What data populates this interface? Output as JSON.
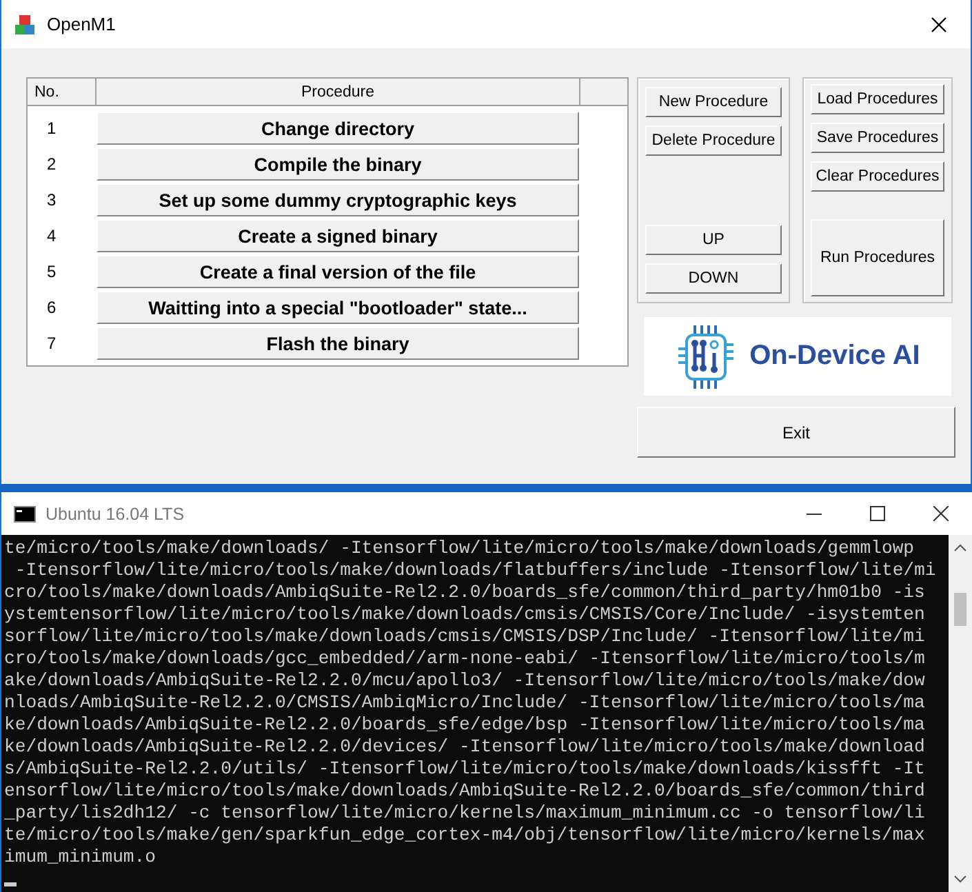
{
  "window": {
    "title": "OpenM1"
  },
  "table": {
    "columns": [
      "No.",
      "Procedure"
    ],
    "rows": [
      {
        "number": "1",
        "procedure": "Change directory"
      },
      {
        "number": "2",
        "procedure": "Compile the binary"
      },
      {
        "number": "3",
        "procedure": "Set up some dummy cryptographic keys"
      },
      {
        "number": "4",
        "procedure": "Create a signed binary"
      },
      {
        "number": "5",
        "procedure": "Create a final version of the file"
      },
      {
        "number": "6",
        "procedure": "Waitting into a special \"bootloader\" state..."
      },
      {
        "number": "7",
        "procedure": "Flash the binary"
      }
    ]
  },
  "edit_buttons": {
    "top": [
      "New Procedure",
      "Delete Procedure"
    ],
    "bottom": [
      "UP",
      "DOWN"
    ]
  },
  "file_buttons": {
    "top": [
      "Load Procedures",
      "Save Procedures",
      "Clear Procedures"
    ],
    "run": "Run Procedures"
  },
  "logo": {
    "text": "On-Device AI"
  },
  "exit_button": "Exit",
  "console": {
    "title": "Ubuntu 16.04 LTS",
    "lines": [
      "te/micro/tools/make/downloads/ -Itensorflow/lite/micro/tools/make/downloads/gemmlowp",
      " -Itensorflow/lite/micro/tools/make/downloads/flatbuffers/include -Itensorflow/lite/mi",
      "cro/tools/make/downloads/AmbiqSuite-Rel2.2.0/boards_sfe/common/third_party/hm01b0 -is",
      "ystemtensorflow/lite/micro/tools/make/downloads/cmsis/CMSIS/Core/Include/ -isystemten",
      "sorflow/lite/micro/tools/make/downloads/cmsis/CMSIS/DSP/Include/ -Itensorflow/lite/mi",
      "cro/tools/make/downloads/gcc_embedded//arm-none-eabi/ -Itensorflow/lite/micro/tools/m",
      "ake/downloads/AmbiqSuite-Rel2.2.0/mcu/apollo3/ -Itensorflow/lite/micro/tools/make/dow",
      "nloads/AmbiqSuite-Rel2.2.0/CMSIS/AmbiqMicro/Include/ -Itensorflow/lite/micro/tools/ma",
      "ke/downloads/AmbiqSuite-Rel2.2.0/boards_sfe/edge/bsp -Itensorflow/lite/micro/tools/ma",
      "ke/downloads/AmbiqSuite-Rel2.2.0/devices/ -Itensorflow/lite/micro/tools/make/download",
      "s/AmbiqSuite-Rel2.2.0/utils/ -Itensorflow/lite/micro/tools/make/downloads/kissfft -It",
      "ensorflow/lite/micro/tools/make/downloads/AmbiqSuite-Rel2.2.0/boards_sfe/common/third",
      "_party/lis2dh12/ -c tensorflow/lite/micro/kernels/maximum_minimum.cc -o tensorflow/li",
      "te/micro/tools/make/gen/sparkfun_edge_cortex-m4/obj/tensorflow/lite/micro/kernels/max",
      "imum_minimum.o"
    ]
  }
}
